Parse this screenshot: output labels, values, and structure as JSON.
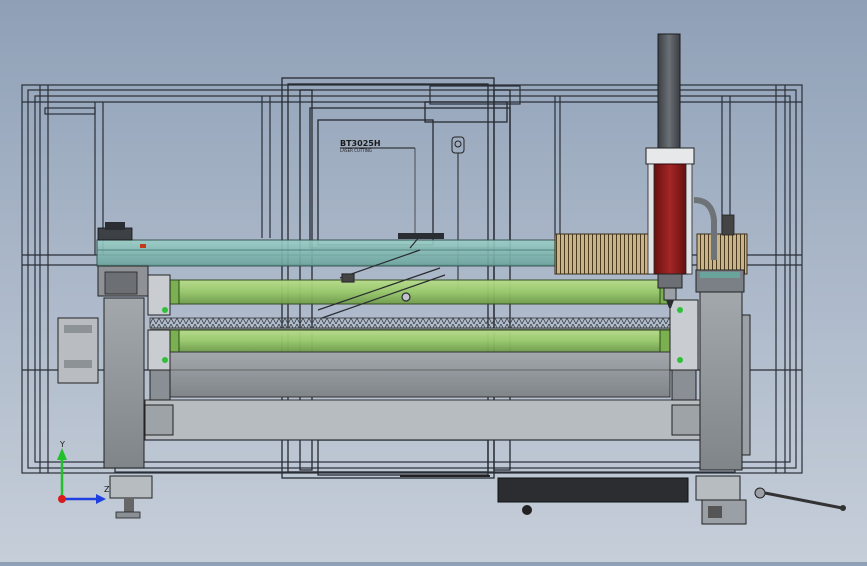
{
  "model": {
    "part_label": "BT3025H",
    "part_sublabel": "LASER CUTTING"
  },
  "triad": {
    "y_label": "Y",
    "z_label": "Z",
    "colors": {
      "y": "#22c02a",
      "z": "#1f3fe0",
      "x": "#d81b1b"
    }
  },
  "colors": {
    "frame_line": "#2a2f38",
    "bed": "#7fb7b0",
    "rail": "#98c96a",
    "head": "#8c1b1b",
    "panel_gray": "#8e9296",
    "stand_dark": "#333538"
  }
}
